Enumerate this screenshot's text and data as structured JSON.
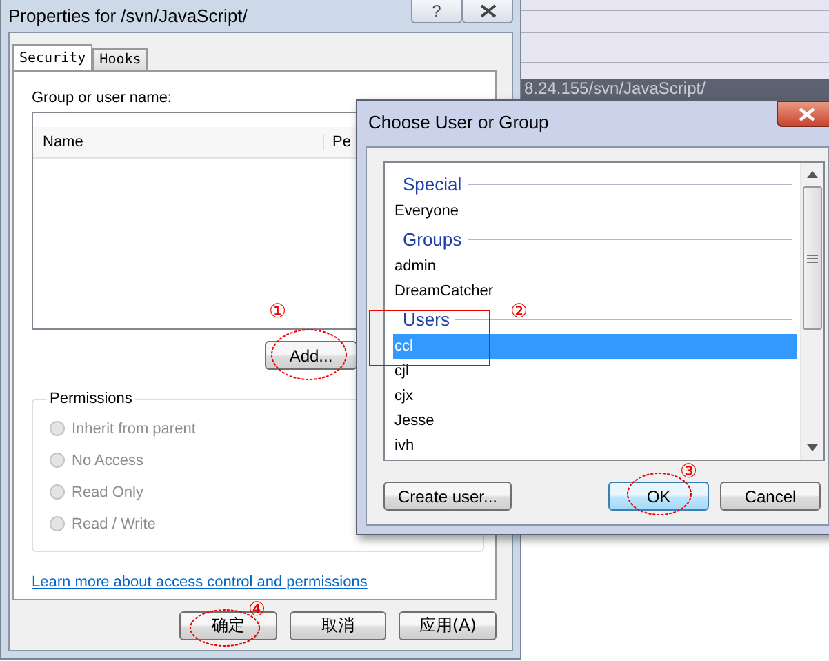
{
  "background_window": {
    "address": "8.24.155/svn/JavaScript/"
  },
  "properties_window": {
    "title": "Properties for /svn/JavaScript/",
    "help_button": "?",
    "tabs": [
      {
        "label": "Security",
        "selected": true
      },
      {
        "label": "Hooks",
        "selected": false
      }
    ],
    "group_label": "Group or user name:",
    "columns": [
      "Name",
      "Pe"
    ],
    "add_button": "Add...",
    "permissions": {
      "title": "Permissions",
      "options": [
        {
          "label": "Inherit from parent",
          "selected": false,
          "disabled": true
        },
        {
          "label": "No Access",
          "selected": false,
          "disabled": true
        },
        {
          "label": "Read Only",
          "selected": false,
          "disabled": true
        },
        {
          "label": "Read / Write",
          "selected": false,
          "disabled": true
        }
      ]
    },
    "link": "Learn more about access control and permissions",
    "buttons": [
      "确定",
      "取消",
      "应用(A)"
    ]
  },
  "choose_dialog": {
    "title": "Choose User or Group",
    "items": [
      {
        "kind": "header",
        "label": "Special"
      },
      {
        "kind": "entry",
        "label": "Everyone",
        "selected": false
      },
      {
        "kind": "header",
        "label": "Groups"
      },
      {
        "kind": "entry",
        "label": "admin",
        "selected": false
      },
      {
        "kind": "entry",
        "label": "DreamCatcher",
        "selected": false
      },
      {
        "kind": "header",
        "label": "Users"
      },
      {
        "kind": "entry",
        "label": "ccl",
        "selected": true
      },
      {
        "kind": "entry",
        "label": "cjl",
        "selected": false
      },
      {
        "kind": "entry",
        "label": "cjx",
        "selected": false
      },
      {
        "kind": "entry",
        "label": "Jesse",
        "selected": false
      },
      {
        "kind": "entry",
        "label": "ivh",
        "selected": false
      }
    ],
    "buttons": [
      {
        "label": "Create user...",
        "default": false
      },
      {
        "label": "OK",
        "default": true
      },
      {
        "label": "Cancel",
        "default": false
      }
    ]
  },
  "annotations": [
    "①",
    "②",
    "③",
    "④"
  ]
}
